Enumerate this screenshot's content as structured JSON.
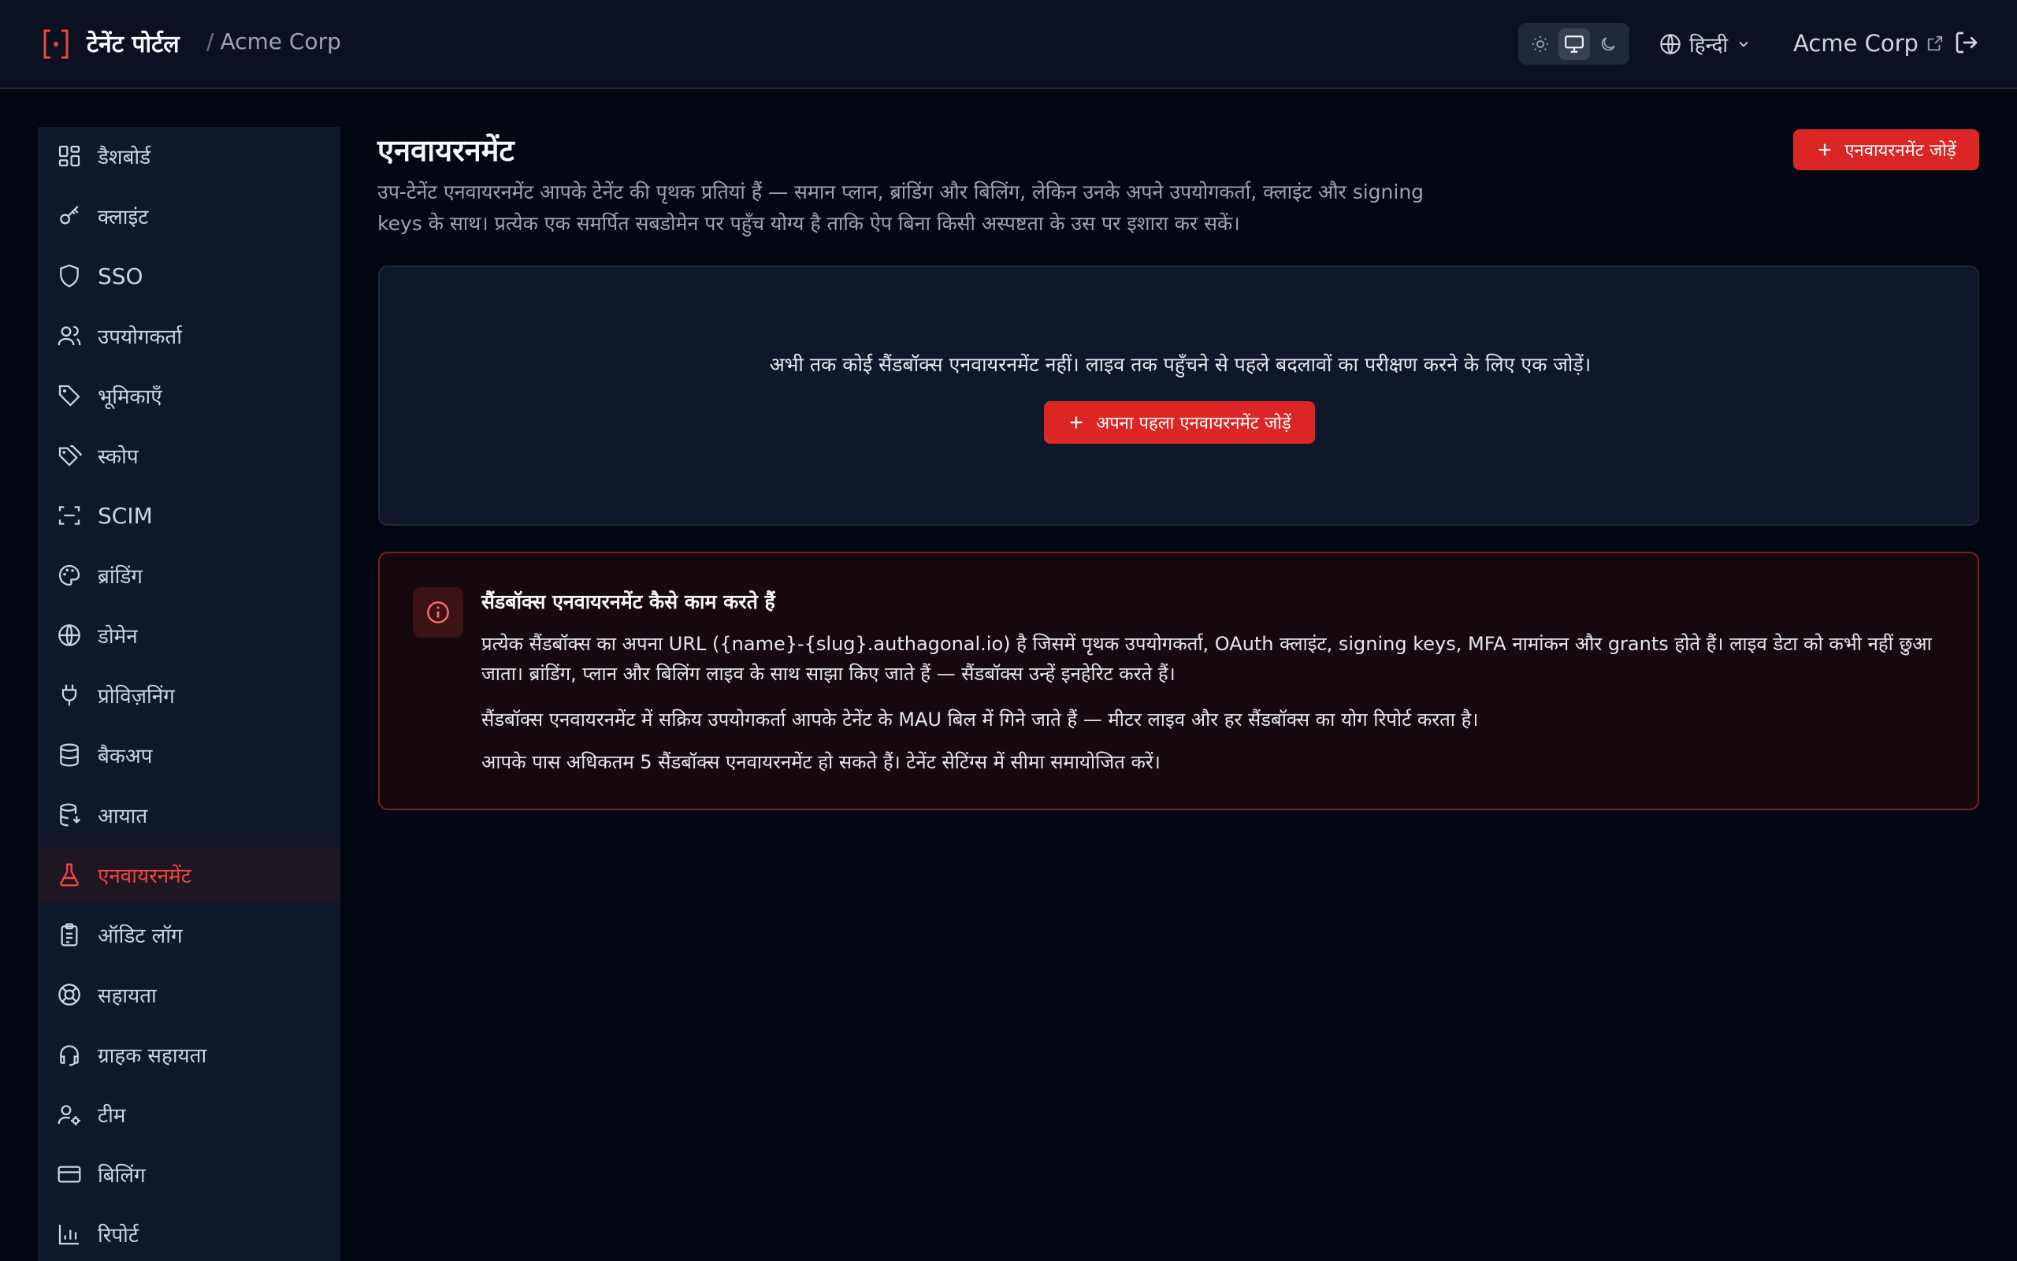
{
  "header": {
    "brand_title": "टेनेंट पोर्टल",
    "separator": "/",
    "org_breadcrumb": "Acme Corp",
    "theme_options": [
      "light-icon",
      "system-icon",
      "dark-icon"
    ],
    "theme_selected": "system",
    "language": "हिन्दी",
    "org_link": "Acme Corp"
  },
  "sidebar": {
    "items": [
      {
        "label": "डैशबोर्ड",
        "icon": "dashboard-icon"
      },
      {
        "label": "क्लाइंट",
        "icon": "key-icon"
      },
      {
        "label": "SSO",
        "icon": "shield-icon"
      },
      {
        "label": "उपयोगकर्ता",
        "icon": "users-icon"
      },
      {
        "label": "भूमिकाएँ",
        "icon": "tag-icon"
      },
      {
        "label": "स्कोप",
        "icon": "tags-icon"
      },
      {
        "label": "SCIM",
        "icon": "scan-icon"
      },
      {
        "label": "ब्रांडिंग",
        "icon": "palette-icon"
      },
      {
        "label": "डोमेन",
        "icon": "globe-icon"
      },
      {
        "label": "प्रोविज़निंग",
        "icon": "plug-icon"
      },
      {
        "label": "बैकअप",
        "icon": "database-icon"
      },
      {
        "label": "आयात",
        "icon": "database-import-icon"
      },
      {
        "label": "एनवायरनमेंट",
        "icon": "flask-icon"
      },
      {
        "label": "ऑडिट लॉग",
        "icon": "clipboard-icon"
      },
      {
        "label": "सहायता",
        "icon": "lifebuoy-icon"
      },
      {
        "label": "ग्राहक सहायता",
        "icon": "headset-icon"
      },
      {
        "label": "टीम",
        "icon": "user-cog-icon"
      },
      {
        "label": "बिलिंग",
        "icon": "credit-card-icon"
      },
      {
        "label": "रिपोर्ट",
        "icon": "bar-chart-icon"
      }
    ],
    "active_index": 12
  },
  "main": {
    "title": "एनवायरनमेंट",
    "description": "उप-टेनेंट एनवायरनमेंट आपके टेनेंट की पृथक प्रतियां हैं — समान प्लान, ब्रांडिंग और बिलिंग, लेकिन उनके अपने उपयोगकर्ता, क्लाइंट और signing keys के साथ। प्रत्येक एक समर्पित सबडोमेन पर पहुँच योग्य है ताकि ऐप बिना किसी अस्पष्टता के उस पर इशारा कर सकें।",
    "add_button": "एनवायरनमेंट जोड़ें",
    "empty_state": {
      "message": "अभी तक कोई सैंडबॉक्स एनवायरनमेंट नहीं। लाइव तक पहुँचने से पहले बदलावों का परीक्षण करने के लिए एक जोड़ें।",
      "button": "अपना पहला एनवायरनमेंट जोड़ें"
    },
    "info": {
      "title": "सैंडबॉक्स एनवायरनमेंट कैसे काम करते हैं",
      "p1": "प्रत्येक सैंडबॉक्स का अपना URL ({name}-{slug}.authagonal.io) है जिसमें पृथक उपयोगकर्ता, OAuth क्लाइंट, signing keys, MFA नामांकन और grants होते हैं। लाइव डेटा को कभी नहीं छुआ जाता। ब्रांडिंग, प्लान और बिलिंग लाइव के साथ साझा किए जाते हैं — सैंडबॉक्स उन्हें इनहेरिट करते हैं।",
      "p2": "सैंडबॉक्स एनवायरनमेंट में सक्रिय उपयोगकर्ता आपके टेनेंट के MAU बिल में गिने जाते हैं — मीटर लाइव और हर सैंडबॉक्स का योग रिपोर्ट करता है।",
      "p3": "आपके पास अधिकतम 5 सैंडबॉक्स एनवायरनमेंट हो सकते हैं। टेनेंट सेटिंग्स में सीमा समायोजित करें।"
    }
  },
  "colors": {
    "accent": "#dc2626",
    "active_text": "#ef4444",
    "background": "#030712",
    "panel": "#0f172a"
  }
}
